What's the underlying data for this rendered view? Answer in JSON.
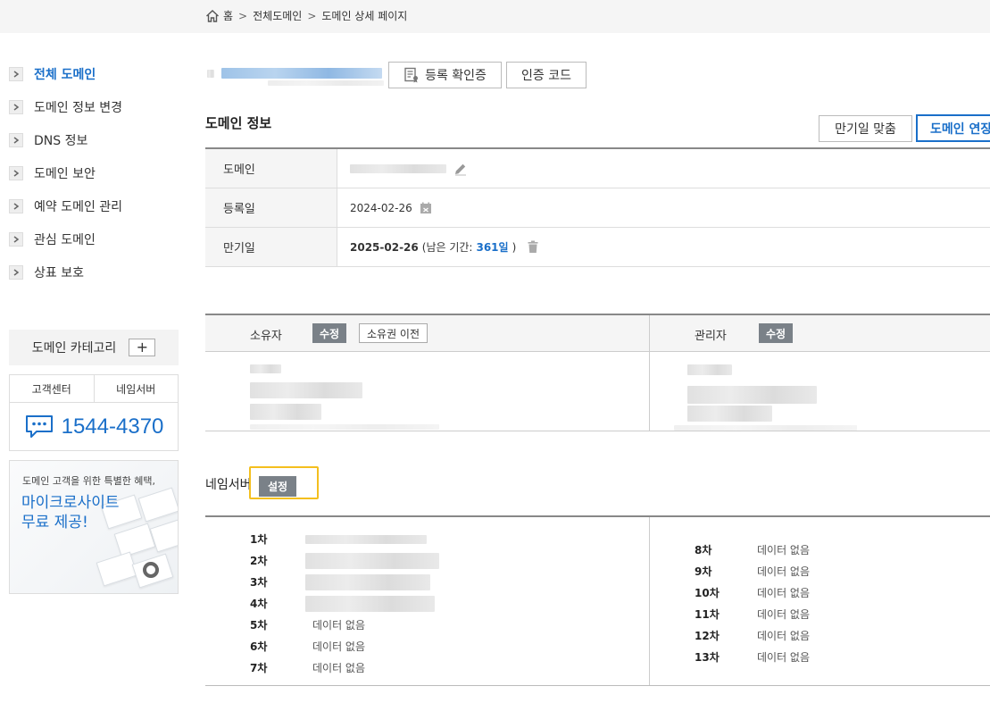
{
  "breadcrumb": {
    "home": "홈",
    "sep": ">",
    "level1": "전체도메인",
    "level2": "도메인 상세 페이지"
  },
  "sidebar": {
    "items": [
      {
        "label": "전체 도메인",
        "active": true
      },
      {
        "label": "도메인 정보 변경"
      },
      {
        "label": "DNS 정보"
      },
      {
        "label": "도메인 보안"
      },
      {
        "label": "예약 도메인 관리"
      },
      {
        "label": "관심 도메인"
      },
      {
        "label": "상표 보호"
      }
    ],
    "category_label": "도메인 카테고리",
    "category_add": "+",
    "cs_tabs": [
      "고객센터",
      "네임서버"
    ],
    "phone": "1544-4370",
    "promo_small": "도메인 고객을 위한 특별한 혜택,",
    "promo_line1": "마이크로사이트",
    "promo_line2": "무료 제공!"
  },
  "header_buttons": {
    "certificate": "등록 확인증",
    "auth_code": "인증 코드"
  },
  "domain_info": {
    "title": "도메인 정보",
    "btn_match_expiry": "만기일 맞춤",
    "btn_extend": "도메인 연장",
    "rows": {
      "domain_label": "도메인",
      "registered_label": "등록일",
      "registered_value": "2024-02-26",
      "expiry_label": "만기일",
      "expiry_value": "2025-02-26",
      "remaining_prefix": "(남은 기간:",
      "remaining_days": "361일",
      "remaining_suffix": ")"
    }
  },
  "contacts": {
    "owner_label": "소유자",
    "owner_edit": "수정",
    "owner_transfer": "소유권 이전",
    "admin_label": "관리자",
    "admin_edit": "수정"
  },
  "nameserver": {
    "title": "네임서버",
    "setting": "설정",
    "left": [
      {
        "n": "1차",
        "v": ""
      },
      {
        "n": "2차",
        "v": ""
      },
      {
        "n": "3차",
        "v": ""
      },
      {
        "n": "4차",
        "v": ""
      },
      {
        "n": "5차",
        "v": "데이터 없음"
      },
      {
        "n": "6차",
        "v": "데이터 없음"
      },
      {
        "n": "7차",
        "v": "데이터 없음"
      }
    ],
    "right": [
      {
        "n": "8차",
        "v": "데이터 없음"
      },
      {
        "n": "9차",
        "v": "데이터 없음"
      },
      {
        "n": "10차",
        "v": "데이터 없음"
      },
      {
        "n": "11차",
        "v": "데이터 없음"
      },
      {
        "n": "12차",
        "v": "데이터 없음"
      },
      {
        "n": "13차",
        "v": "데이터 없음"
      }
    ]
  },
  "colors": {
    "accent": "#1a6fc9",
    "tag": "#7a8188",
    "highlight": "#f4bf1e"
  }
}
